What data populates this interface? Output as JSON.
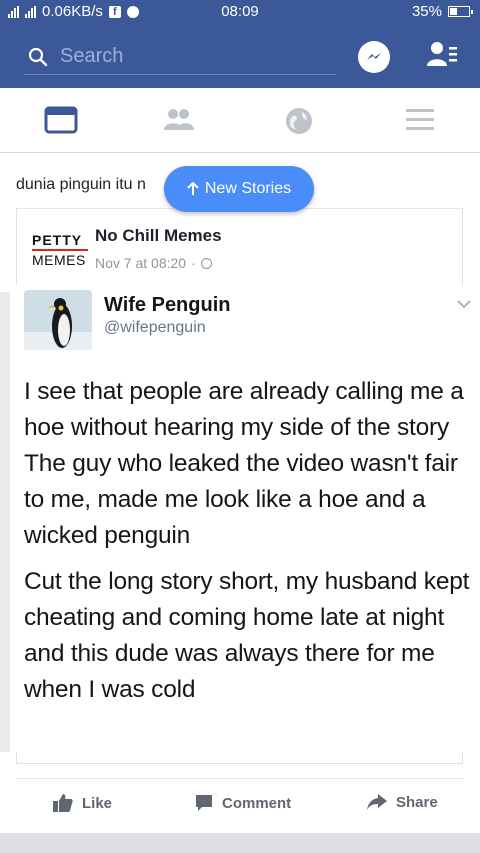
{
  "status_bar": {
    "net_speed": "0.06KB/s",
    "time": "08:09",
    "battery": "35%"
  },
  "header": {
    "search_placeholder": "Search"
  },
  "feed": {
    "shared_text": "dunia pinguin itu n",
    "new_stories_label": "New Stories"
  },
  "post": {
    "page_logo_line1": "PETTY",
    "page_logo_line2": "MEMES",
    "page_name": "No Chill Memes",
    "timestamp": "Nov 7 at 08:20",
    "separator": "·",
    "embedded_tweet": {
      "display_name": "Wife Penguin",
      "handle": "@wifepenguin",
      "paragraphs": [
        "I see that people are already calling me a hoe without hearing my side of the story",
        "The guy who leaked the video wasn't fair to me, made me look like a hoe and a wicked penguin",
        "Cut the long story short, my husband kept cheating and coming home late at night and this dude was always there for me when I was cold"
      ]
    }
  },
  "actions": {
    "like": "Like",
    "comment": "Comment",
    "share": "Share"
  },
  "colors": {
    "brand": "#3b5998",
    "button": "#4b8df8"
  },
  "icons": [
    "search-icon",
    "messenger-icon",
    "friend-requests-icon",
    "news-feed-icon",
    "friends-icon",
    "globe-icon",
    "menu-icon",
    "arrow-up-icon",
    "chevron-down-icon",
    "like-icon",
    "comment-icon",
    "share-icon"
  ]
}
